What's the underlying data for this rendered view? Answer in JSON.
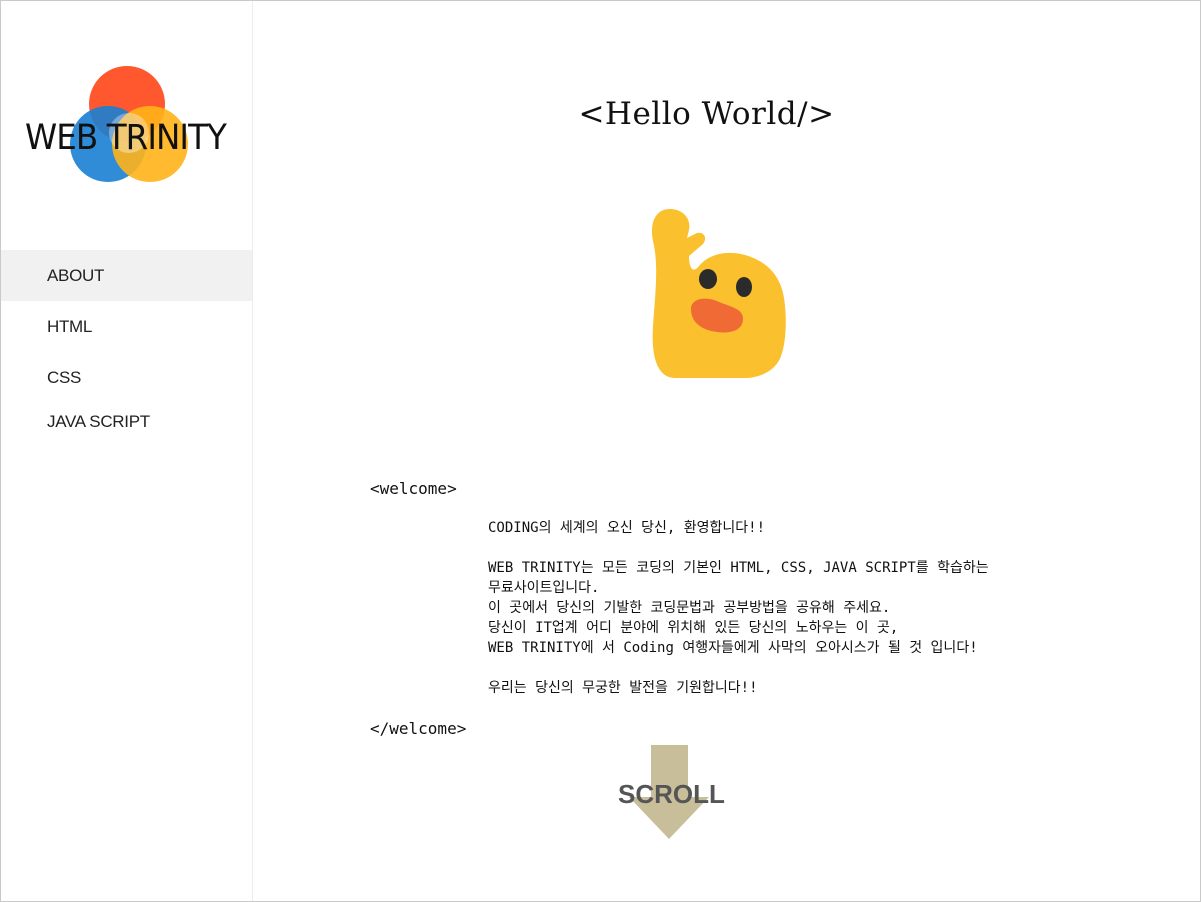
{
  "sidebar": {
    "logo_text": "WEB TRINITY",
    "nav": [
      {
        "label": "ABOUT",
        "active": true
      },
      {
        "label": "HTML"
      },
      {
        "label": "CSS"
      },
      {
        "label": "JAVA SCRIPT"
      }
    ]
  },
  "main": {
    "title": "<Hello World/>",
    "emoji": "waving-blob-icon",
    "welcome": {
      "open_tag": "<welcome>",
      "lines": [
        "CODING의 세계의 오신 당신, 환영합니다!!",
        "",
        "WEB TRINITY는 모든 코딩의 기본인 HTML, CSS, JAVA SCRIPT를 학습하는",
        "무료사이트입니다.",
        "이 곳에서 당신의 기발한 코딩문법과 공부방법을 공유해 주세요.",
        "당신이 IT업계 어디 분야에 위치해 있든 당신의 노하우는 이 곳,",
        "WEB TRINITY에 서 Coding 여행자들에게 사막의 오아시스가 될 것 입니다!",
        "",
        "우리는 당신의 무궁한 발전을 기원합니다!!"
      ],
      "close_tag": "</welcome>"
    },
    "scroll_label": "SCROLL"
  },
  "colors": {
    "logo_red": "#ff4a1c",
    "logo_blue": "#1a7fd1",
    "logo_yellow": "#ffb31a",
    "nav_active_bg": "#f1f1f1",
    "emoji_yellow": "#fbc02d",
    "emoji_mouth": "#f06a35",
    "scroll_arrow": "#c8bf9a"
  }
}
